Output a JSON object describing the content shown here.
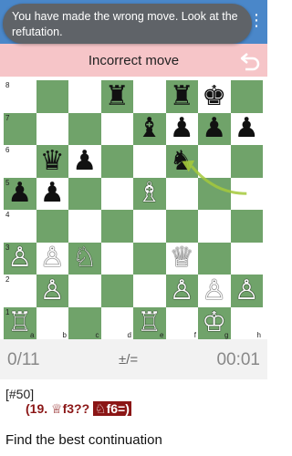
{
  "toast": {
    "message": "You have made the wrong move. Look at the refutation."
  },
  "status": {
    "text": "Incorrect move"
  },
  "board": {
    "ranks": [
      "8",
      "7",
      "6",
      "5",
      "4",
      "3",
      "2",
      "1"
    ],
    "files": [
      "a",
      "b",
      "c",
      "d",
      "e",
      "f",
      "g",
      "h"
    ],
    "pieces": {
      "d8": "♜",
      "f8": "♜",
      "g8": "♚",
      "e7": "♝",
      "f7": "♟",
      "g7": "♟",
      "h7": "♟",
      "b6": "♛",
      "c6": "♟",
      "f6": "♞",
      "a5": "♟",
      "b5": "♟",
      "e5": "♗",
      "a3": "♙",
      "b3": "♙",
      "c3": "♘",
      "f3": "♕",
      "b2": "♙",
      "f2": "♙",
      "g2": "♙",
      "h2": "♙",
      "a1": "♖",
      "e1": "♖",
      "g1": "♔"
    },
    "arrow": {
      "from": "h5",
      "to": "f6",
      "color": "#a4c93b"
    }
  },
  "info": {
    "progress": "0/11",
    "eval": "±/=",
    "timer": "00:01"
  },
  "puzzle": {
    "id": "[#50]",
    "move_num": "(19.",
    "queen_icon": "♕",
    "move1": "f3??",
    "knight_icon": "♘",
    "move2": "f6=)"
  },
  "prompt": "Find the best continuation"
}
